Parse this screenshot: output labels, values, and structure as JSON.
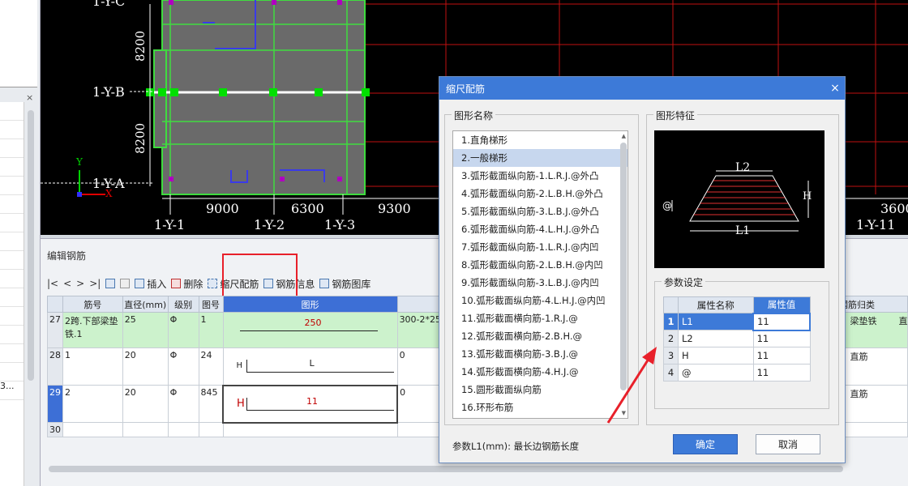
{
  "cad": {
    "axis_rows": [
      "1-Y-C",
      "1-Y-B",
      "1-Y-A"
    ],
    "dims_vertical": [
      "8200",
      "8200"
    ],
    "dims_horizontal": [
      "9000",
      "6300",
      "9300",
      "3600"
    ],
    "axis_cols": [
      "1-Y-1",
      "1-Y-2",
      "1-Y-3",
      "1-Y-11"
    ],
    "axis_x": "X",
    "axis_y": "Y"
  },
  "left": {
    "close": "×",
    "trunc_text": "3..."
  },
  "editor": {
    "title": "编辑钢筋",
    "toolbar": {
      "first": "|<",
      "prev": "<",
      "next": ">",
      "last": ">|",
      "insert": "插入",
      "delete": "删除",
      "scale_rebar": "缩尺配筋",
      "rebar_info": "钢筋信息",
      "rebar_library": "钢筋图库"
    },
    "columns": [
      "筋号",
      "直径(mm)",
      "级别",
      "图号",
      "图形",
      "钢筋归类"
    ],
    "rows": [
      {
        "n": "27",
        "name": "2跨.下部梁垫铁.1",
        "dia": "25",
        "grade": "Φ",
        "fig": "1",
        "shape_label": "250",
        "formula": "300-2*25",
        "category": "梁垫铁",
        "extra": "直"
      },
      {
        "n": "28",
        "name": "1",
        "dia": "20",
        "grade": "Φ",
        "fig": "24",
        "shape_h": "H",
        "shape_label": "L",
        "formula": "0",
        "category": "直筋",
        "extra": ""
      },
      {
        "n": "29",
        "name": "2",
        "dia": "20",
        "grade": "Φ",
        "fig": "845",
        "shape_h": "H",
        "shape_label": "11",
        "formula": "0",
        "category": "直筋",
        "extra": ""
      },
      {
        "n": "30"
      }
    ]
  },
  "dialog": {
    "title": "缩尺配筋",
    "close": "×",
    "shape_group": "图形名称",
    "feature_group": "图形特征",
    "param_group": "参数设定",
    "shapes": [
      "1.直角梯形",
      "2.一般梯形",
      "3.弧形截面纵向筋-1.L.R.J.@外凸",
      "4.弧形截面纵向筋-2.L.B.H.@外凸",
      "5.弧形截面纵向筋-3.L.B.J.@外凸",
      "6.弧形截面纵向筋-4.L.H.J.@外凸",
      "7.弧形截面纵向筋-1.L.R.J.@内凹",
      "8.弧形截面纵向筋-2.L.B.H.@内凹",
      "9.弧形截面纵向筋-3.L.B.J.@内凹",
      "10.弧形截面纵向筋-4.L.H.J.@内凹",
      "11.弧形截面横向筋-1.R.J.@",
      "12.弧形截面横向筋-2.B.H.@",
      "13.弧形截面横向筋-3.B.J.@",
      "14.弧形截面横向筋-4.H.J.@",
      "15.圆形截面纵向筋",
      "16.环形布筋"
    ],
    "preview_labels": {
      "top": "L2",
      "bottom": "L1",
      "height": "H",
      "spacing": "@"
    },
    "param_headers": [
      "属性名称",
      "属性值"
    ],
    "params": [
      {
        "n": "1",
        "name": "L1",
        "value": "11"
      },
      {
        "n": "2",
        "name": "L2",
        "value": "11"
      },
      {
        "n": "3",
        "name": "H",
        "value": "11"
      },
      {
        "n": "4",
        "name": "@",
        "value": "11"
      }
    ],
    "hint": "参数L1(mm): 最长边钢筋长度",
    "ok": "确定",
    "cancel": "取消"
  }
}
